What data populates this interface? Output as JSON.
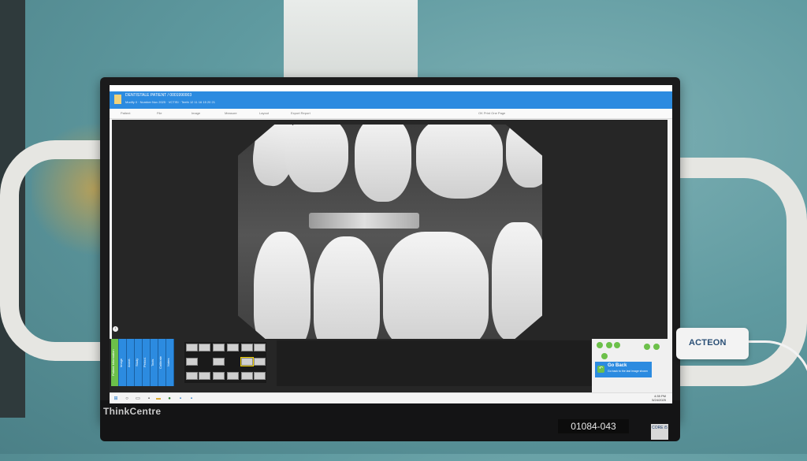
{
  "scene": "photo of clinic monitor showing dental x-ray software",
  "monitor": {
    "brand": "ThinkCentre",
    "asset_tag": "01084-043",
    "badge": "CORE i5"
  },
  "app": {
    "patient_line": "DENTISTALE PATIENT / 0001990003",
    "patient_sub": "Modify  0 · Number Nov 2025 · VCTISI · Teeth 12 11 16 15 20 21",
    "toolbar": [
      "Patient",
      "File",
      "Image",
      "Measure",
      "Layout",
      "Export Report"
    ],
    "toolbar_right": "OK Print One Page",
    "tabs": [
      "Patient Information",
      "Image",
      "Annot.",
      "Study",
      "Period.",
      "Tools",
      "Calibrate",
      "Notes"
    ],
    "go_back": {
      "title": "Go Back",
      "subtitle": "Go back to the last image shown"
    },
    "clock": {
      "time": "4:35 PM",
      "date": "5/24/2025"
    }
  },
  "device": {
    "label": "ACTEON"
  },
  "colors": {
    "accent": "#2c8be0",
    "green": "#6cc04a",
    "wall": "#5f9aa0"
  }
}
